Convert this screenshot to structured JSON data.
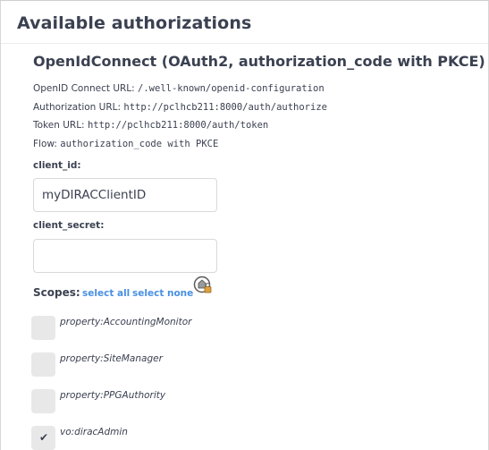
{
  "modal": {
    "title": "Available authorizations"
  },
  "scheme": {
    "title": "OpenIdConnect (OAuth2, authorization_code with PKCE)",
    "openid_label": "OpenID Connect URL:",
    "openid_value": "/.well-known/openid-configuration",
    "auth_label": "Authorization URL:",
    "auth_value": "http://pclhcb211:8000/auth/authorize",
    "token_label": "Token URL:",
    "token_value": "http://pclhcb211:8000/auth/token",
    "flow_label": "Flow:",
    "flow_value": "authorization_code with PKCE"
  },
  "client_id": {
    "label": "client_id:",
    "value": "myDIRACClientID"
  },
  "client_secret": {
    "label": "client_secret:",
    "value": ""
  },
  "scopes": {
    "label": "Scopes:",
    "select_all": "select all",
    "select_none": "select none",
    "items": [
      {
        "name": "property:AccountingMonitor",
        "checked": false
      },
      {
        "name": "property:SiteManager",
        "checked": false
      },
      {
        "name": "property:PPGAuthority",
        "checked": false
      },
      {
        "name": "vo:diracAdmin",
        "checked": true
      }
    ]
  },
  "icons": {
    "lock": "lock-icon",
    "check": "check-icon"
  },
  "colors": {
    "link": "#4990e2",
    "text": "#3b4151",
    "checkbox_bg": "#e8e8e8"
  }
}
